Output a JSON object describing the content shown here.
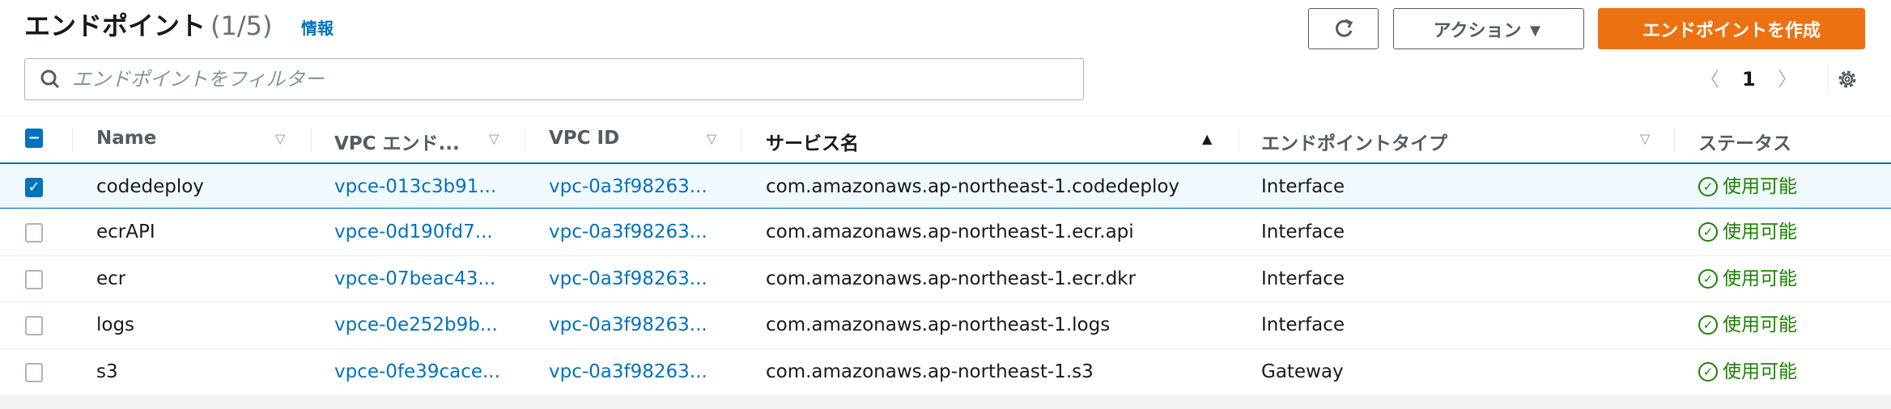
{
  "header": {
    "title": "エンドポイント",
    "count": "(1/5)",
    "info": "情報"
  },
  "toolbar": {
    "refresh_icon": "refresh-icon",
    "actions_label": "アクション ▼",
    "create_label": "エンドポイントを作成"
  },
  "filter": {
    "placeholder": "エンドポイントをフィルター",
    "value": ""
  },
  "pagination": {
    "prev": "〈",
    "page": "1",
    "next": "〉",
    "settings_icon": "gear-icon"
  },
  "columns": [
    {
      "label": "Name",
      "sort": "▽"
    },
    {
      "label": "VPC エンド...",
      "sort": "▽"
    },
    {
      "label": "VPC ID",
      "sort": "▽"
    },
    {
      "label": "サービス名",
      "sort": "▲"
    },
    {
      "label": "エンドポイントタイプ",
      "sort": "▽"
    },
    {
      "label": "ステータス"
    }
  ],
  "rows": [
    {
      "selected": true,
      "name": "codedeploy",
      "endpoint_id": "vpce-013c3b91...",
      "vpc_id": "vpc-0a3f98263...",
      "service": "com.amazonaws.ap-northeast-1.codedeploy",
      "type": "Interface",
      "status": "使用可能"
    },
    {
      "selected": false,
      "name": "ecrAPI",
      "endpoint_id": "vpce-0d190fd7...",
      "vpc_id": "vpc-0a3f98263...",
      "service": "com.amazonaws.ap-northeast-1.ecr.api",
      "type": "Interface",
      "status": "使用可能"
    },
    {
      "selected": false,
      "name": "ecr",
      "endpoint_id": "vpce-07beac43...",
      "vpc_id": "vpc-0a3f98263...",
      "service": "com.amazonaws.ap-northeast-1.ecr.dkr",
      "type": "Interface",
      "status": "使用可能"
    },
    {
      "selected": false,
      "name": "logs",
      "endpoint_id": "vpce-0e252b9b...",
      "vpc_id": "vpc-0a3f98263...",
      "service": "com.amazonaws.ap-northeast-1.logs",
      "type": "Interface",
      "status": "使用可能"
    },
    {
      "selected": false,
      "name": "s3",
      "endpoint_id": "vpce-0fe39cace...",
      "vpc_id": "vpc-0a3f98263...",
      "service": "com.amazonaws.ap-northeast-1.s3",
      "type": "Gateway",
      "status": "使用可能"
    }
  ],
  "colors": {
    "accent": "#ec7211",
    "link": "#0073bb",
    "success": "#1d8102"
  }
}
